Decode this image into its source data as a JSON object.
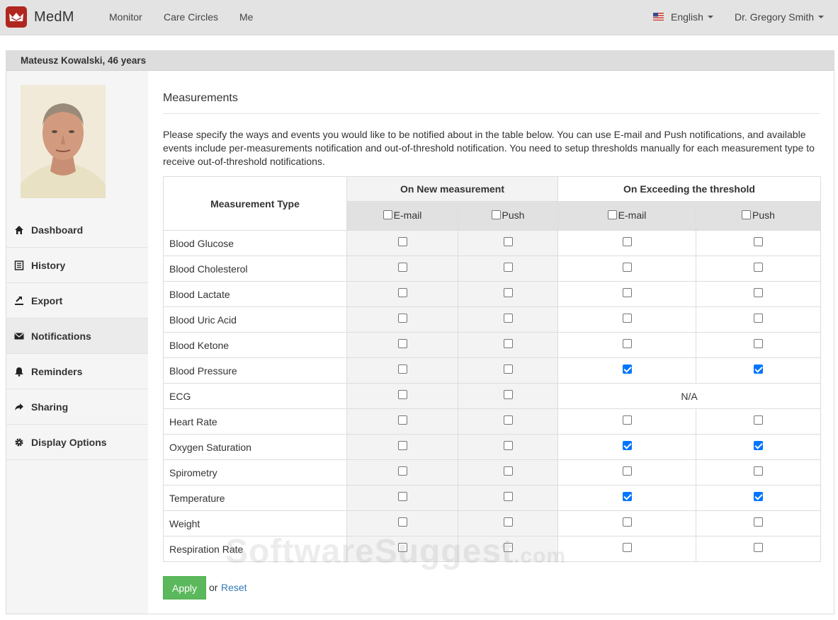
{
  "brand": {
    "name": "MedM"
  },
  "nav": {
    "links": [
      "Monitor",
      "Care Circles",
      "Me"
    ],
    "language": "English",
    "user": "Dr. Gregory Smith"
  },
  "patient": {
    "header": "Mateusz Kowalski, 46 years"
  },
  "sidebar": {
    "items": [
      {
        "label": "Dashboard",
        "icon": "home-icon"
      },
      {
        "label": "History",
        "icon": "list-icon"
      },
      {
        "label": "Export",
        "icon": "export-icon"
      },
      {
        "label": "Notifications",
        "icon": "envelope-icon",
        "active": true
      },
      {
        "label": "Reminders",
        "icon": "bell-icon"
      },
      {
        "label": "Sharing",
        "icon": "share-icon"
      },
      {
        "label": "Display Options",
        "icon": "gear-icon"
      }
    ]
  },
  "main": {
    "title": "Measurements",
    "description": "Please specify the ways and events you would like to be notified about in the table below. You can use E-mail and Push notifications, and available events include per-measurements notification and out-of-threshold notification. You need to setup thresholds manually for each measurement type to receive out-of-threshold notifications.",
    "table": {
      "type_header": "Measurement Type",
      "group_new": "On New measurement",
      "group_threshold": "On Exceeding the threshold",
      "email_label": "E-mail",
      "push_label": "Push",
      "na_label": "N/A",
      "rows": [
        {
          "name": "Blood Glucose",
          "checks": [
            false,
            false,
            false,
            false
          ]
        },
        {
          "name": "Blood Cholesterol",
          "checks": [
            false,
            false,
            false,
            false
          ]
        },
        {
          "name": "Blood Lactate",
          "checks": [
            false,
            false,
            false,
            false
          ]
        },
        {
          "name": "Blood Uric Acid",
          "checks": [
            false,
            false,
            false,
            false
          ]
        },
        {
          "name": "Blood Ketone",
          "checks": [
            false,
            false,
            false,
            false
          ]
        },
        {
          "name": "Blood Pressure",
          "checks": [
            false,
            false,
            true,
            true
          ]
        },
        {
          "name": "ECG",
          "checks": [
            false,
            false
          ],
          "threshold_na": true
        },
        {
          "name": "Heart Rate",
          "checks": [
            false,
            false,
            false,
            false
          ]
        },
        {
          "name": "Oxygen Saturation",
          "checks": [
            false,
            false,
            true,
            true
          ]
        },
        {
          "name": "Spirometry",
          "checks": [
            false,
            false,
            false,
            false
          ]
        },
        {
          "name": "Temperature",
          "checks": [
            false,
            false,
            true,
            true
          ]
        },
        {
          "name": "Weight",
          "checks": [
            false,
            false,
            false,
            false
          ]
        },
        {
          "name": "Respiration Rate",
          "checks": [
            false,
            false,
            false,
            false
          ]
        }
      ]
    },
    "apply_label": "Apply",
    "or_label": "or",
    "reset_label": "Reset"
  },
  "watermark": {
    "main": "SoftwareSuggest",
    "suffix": ".com"
  },
  "colors": {
    "brand_red": "#b0271f",
    "apply_green": "#5cb85c",
    "link_blue": "#337ab7",
    "check_blue": "#0075ff"
  }
}
